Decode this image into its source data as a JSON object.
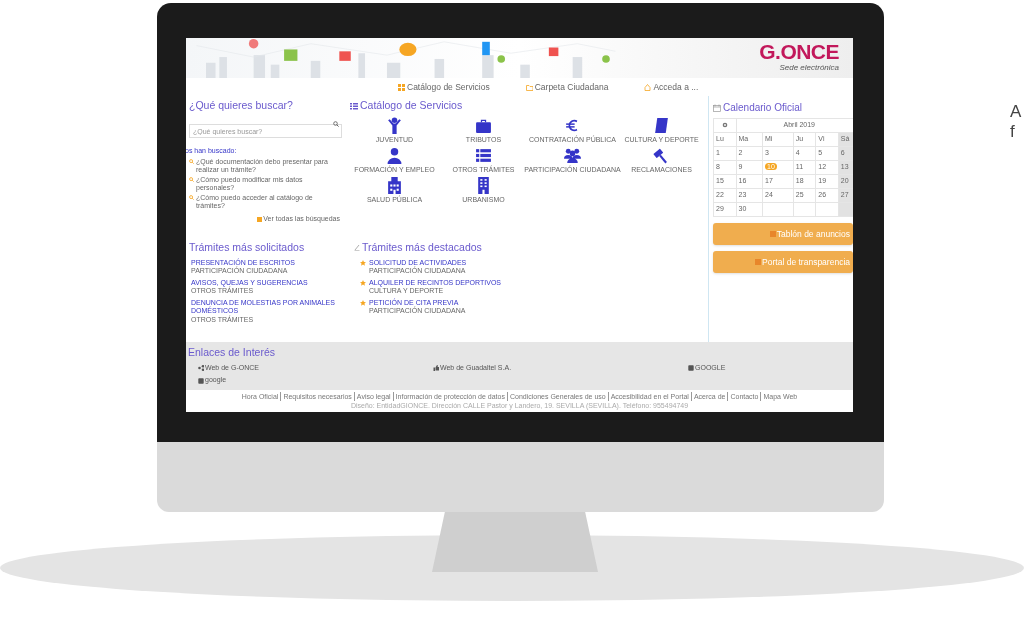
{
  "banner": {
    "logo": "G.ONCE",
    "subtitle": "Sede electrónica"
  },
  "nav": [
    {
      "label": "Catálogo de Servicios"
    },
    {
      "label": "Carpeta Ciudadana"
    },
    {
      "label": "Acceda a ..."
    }
  ],
  "search": {
    "title": "¿Qué quieres buscar?",
    "placeholder": "¿Qué quieres buscar?",
    "recent_heading": "os han buscado:",
    "recent": [
      "¿Qué documentación debo presentar para realizar un trámite?",
      "¿Cómo puedo modificar mis datos personales?",
      "¿Cómo puedo acceder al catálogo de trámites?"
    ],
    "see_all": "Ver todas las búsquedas"
  },
  "catalog": {
    "title": "Catálogo de Servicios",
    "items": [
      "JUVENTUD",
      "TRIBUTOS",
      "CONTRATACIÓN PÚBLICA",
      "CULTURA Y DEPORTE",
      "FORMACIÓN Y EMPLEO",
      "OTROS TRÁMITES",
      "PARTICIPACIÓN CIUDADANA",
      "RECLAMACIONES",
      "SALUD PÚBLICA",
      "URBANISMO"
    ]
  },
  "calendar": {
    "title": "Calendario Oficial",
    "month": "Abril 2019",
    "weekdays": [
      "Lu",
      "Ma",
      "Mi",
      "Ju",
      "Vi",
      "Sá"
    ],
    "weeks": [
      [
        {
          "day": "1",
          "selected": false
        },
        {
          "day": "2",
          "selected": false
        },
        {
          "day": "3",
          "selected": false
        },
        {
          "day": "4",
          "selected": false
        },
        {
          "day": "5",
          "selected": false
        },
        {
          "day": "6",
          "selected": false
        }
      ],
      [
        {
          "day": "8",
          "selected": false
        },
        {
          "day": "9",
          "selected": false
        },
        {
          "day": "10",
          "selected": true
        },
        {
          "day": "11",
          "selected": false
        },
        {
          "day": "12",
          "selected": false
        },
        {
          "day": "13",
          "selected": false
        }
      ],
      [
        {
          "day": "15",
          "selected": false
        },
        {
          "day": "16",
          "selected": false
        },
        {
          "day": "17",
          "selected": false
        },
        {
          "day": "18",
          "selected": false
        },
        {
          "day": "19",
          "selected": false
        },
        {
          "day": "20",
          "selected": false
        }
      ],
      [
        {
          "day": "22",
          "selected": false
        },
        {
          "day": "23",
          "selected": false
        },
        {
          "day": "24",
          "selected": false
        },
        {
          "day": "25",
          "selected": false
        },
        {
          "day": "26",
          "selected": false
        },
        {
          "day": "27",
          "selected": false
        }
      ],
      [
        {
          "day": "29",
          "selected": false
        },
        {
          "day": "30",
          "selected": false
        }
      ]
    ]
  },
  "buttons": [
    "Tablón de anuncios",
    "Portal de transparencia"
  ],
  "requested": {
    "title": "Trámites más solicitados",
    "items": [
      {
        "title": "PRESENTACIÓN DE ESCRITOS",
        "category": "PARTICIPACIÓN CIUDADANA"
      },
      {
        "title": "AVISOS, QUEJAS Y SUGERENCIAS",
        "category": "OTROS TRÁMITES"
      },
      {
        "title": "DENUNCIA DE MOLESTIAS POR ANIMALES DOMÉSTICOS",
        "category": "OTROS TRÁMITES"
      }
    ]
  },
  "featured": {
    "title": "Trámites más destacados",
    "items": [
      {
        "title": "SOLICITUD DE ACTIVIDADES",
        "category": "PARTICIPACIÓN CIUDADANA"
      },
      {
        "title": "ALQUILER DE RECINTOS DEPORTIVOS",
        "category": "CULTURA Y DEPORTE"
      },
      {
        "title": "PETICIÓN DE CITA PREVIA",
        "category": "PARTICIPACIÓN CIUDADANA"
      }
    ]
  },
  "links": {
    "title": "Enlaces de Interés",
    "items": [
      "Web de G-ONCE",
      "Web de Guadaltel S.A.",
      "GOOGLE",
      "google"
    ]
  },
  "footer": {
    "links": [
      "Hora Oficial",
      "Requisitos necesarios",
      "Aviso legal",
      "Información de protección de datos",
      "Condiciones Generales de uso",
      "Accesibilidad en el Portal",
      "Acerca de",
      "Contacto",
      "Mapa Web"
    ],
    "address": "Diseño: EntidadGIONCE. Dirección CALLE Pastor y Landero, 19. SEVILLA (SEVILLA). Teléfono: 955494749"
  },
  "side_text": [
    "A",
    "f"
  ]
}
